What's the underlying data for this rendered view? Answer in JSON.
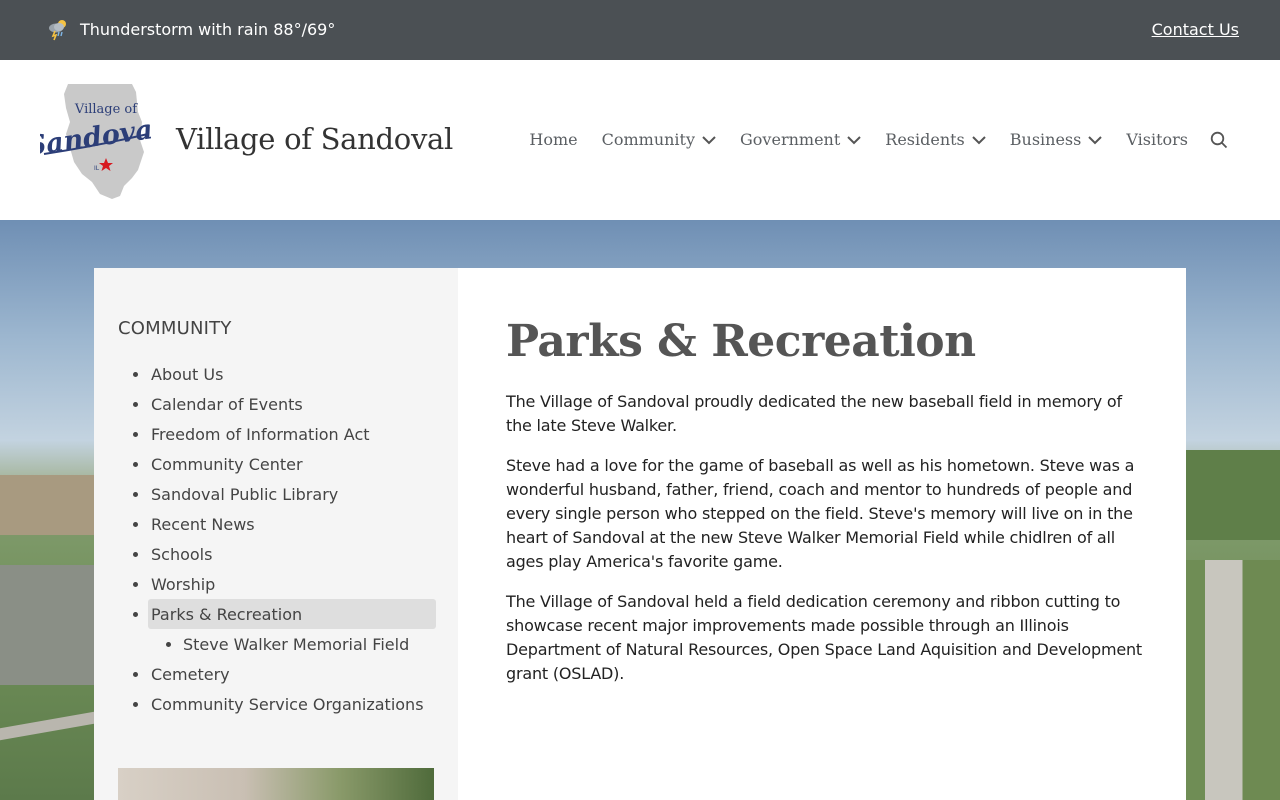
{
  "topbar": {
    "weather_icon": "thunderstorm-icon",
    "weather_text": "Thunderstorm with rain 88°/69°",
    "contact_label": "Contact Us"
  },
  "header": {
    "logo_text_top": "Village of",
    "logo_text_main": "Sandoval",
    "logo_text_small": "IL",
    "site_title": "Village of Sandoval",
    "nav": [
      {
        "label": "Home",
        "has_dropdown": false
      },
      {
        "label": "Community",
        "has_dropdown": true
      },
      {
        "label": "Government",
        "has_dropdown": true
      },
      {
        "label": "Residents",
        "has_dropdown": true
      },
      {
        "label": "Business",
        "has_dropdown": true
      },
      {
        "label": "Visitors",
        "has_dropdown": false
      }
    ],
    "search_icon": "search-icon"
  },
  "sidebar": {
    "heading": "COMMUNITY",
    "items": [
      {
        "label": "About Us"
      },
      {
        "label": "Calendar of Events"
      },
      {
        "label": "Freedom of Information Act"
      },
      {
        "label": "Community Center"
      },
      {
        "label": "Sandoval Public Library"
      },
      {
        "label": "Recent News"
      },
      {
        "label": "Schools"
      },
      {
        "label": "Worship"
      },
      {
        "label": "Parks & Recreation",
        "active": true
      },
      {
        "label": "Steve Walker Memorial Field",
        "sub": true
      },
      {
        "label": "Cemetery"
      },
      {
        "label": "Community Service Organizations"
      }
    ]
  },
  "main": {
    "title": "Parks & Recreation",
    "paragraphs": [
      "The Village of Sandoval proudly dedicated the new baseball field in memory of the late Steve Walker.",
      "Steve had a love for the game of baseball as well as his hometown.  Steve was a wonderful husband, father, friend, coach and mentor to hundreds of people and every single person who stepped on the field.  Steve's memory will live on in the heart of Sandoval at the new Steve Walker Memorial Field while chidlren of all ages play America's favorite game.",
      "The Village of Sandoval held a field dedication ceremony and ribbon cutting to showcase recent major improvements made possible through an Illinois Department of Natural Resources, Open Space Land Aquisition and Development grant (OSLAD)."
    ]
  },
  "colors": {
    "topbar_bg": "#4b5054",
    "sidebar_bg": "#f5f5f5",
    "active_item_bg": "#dedede",
    "logo_blue": "#2c3e78",
    "star_red": "#d71920"
  }
}
